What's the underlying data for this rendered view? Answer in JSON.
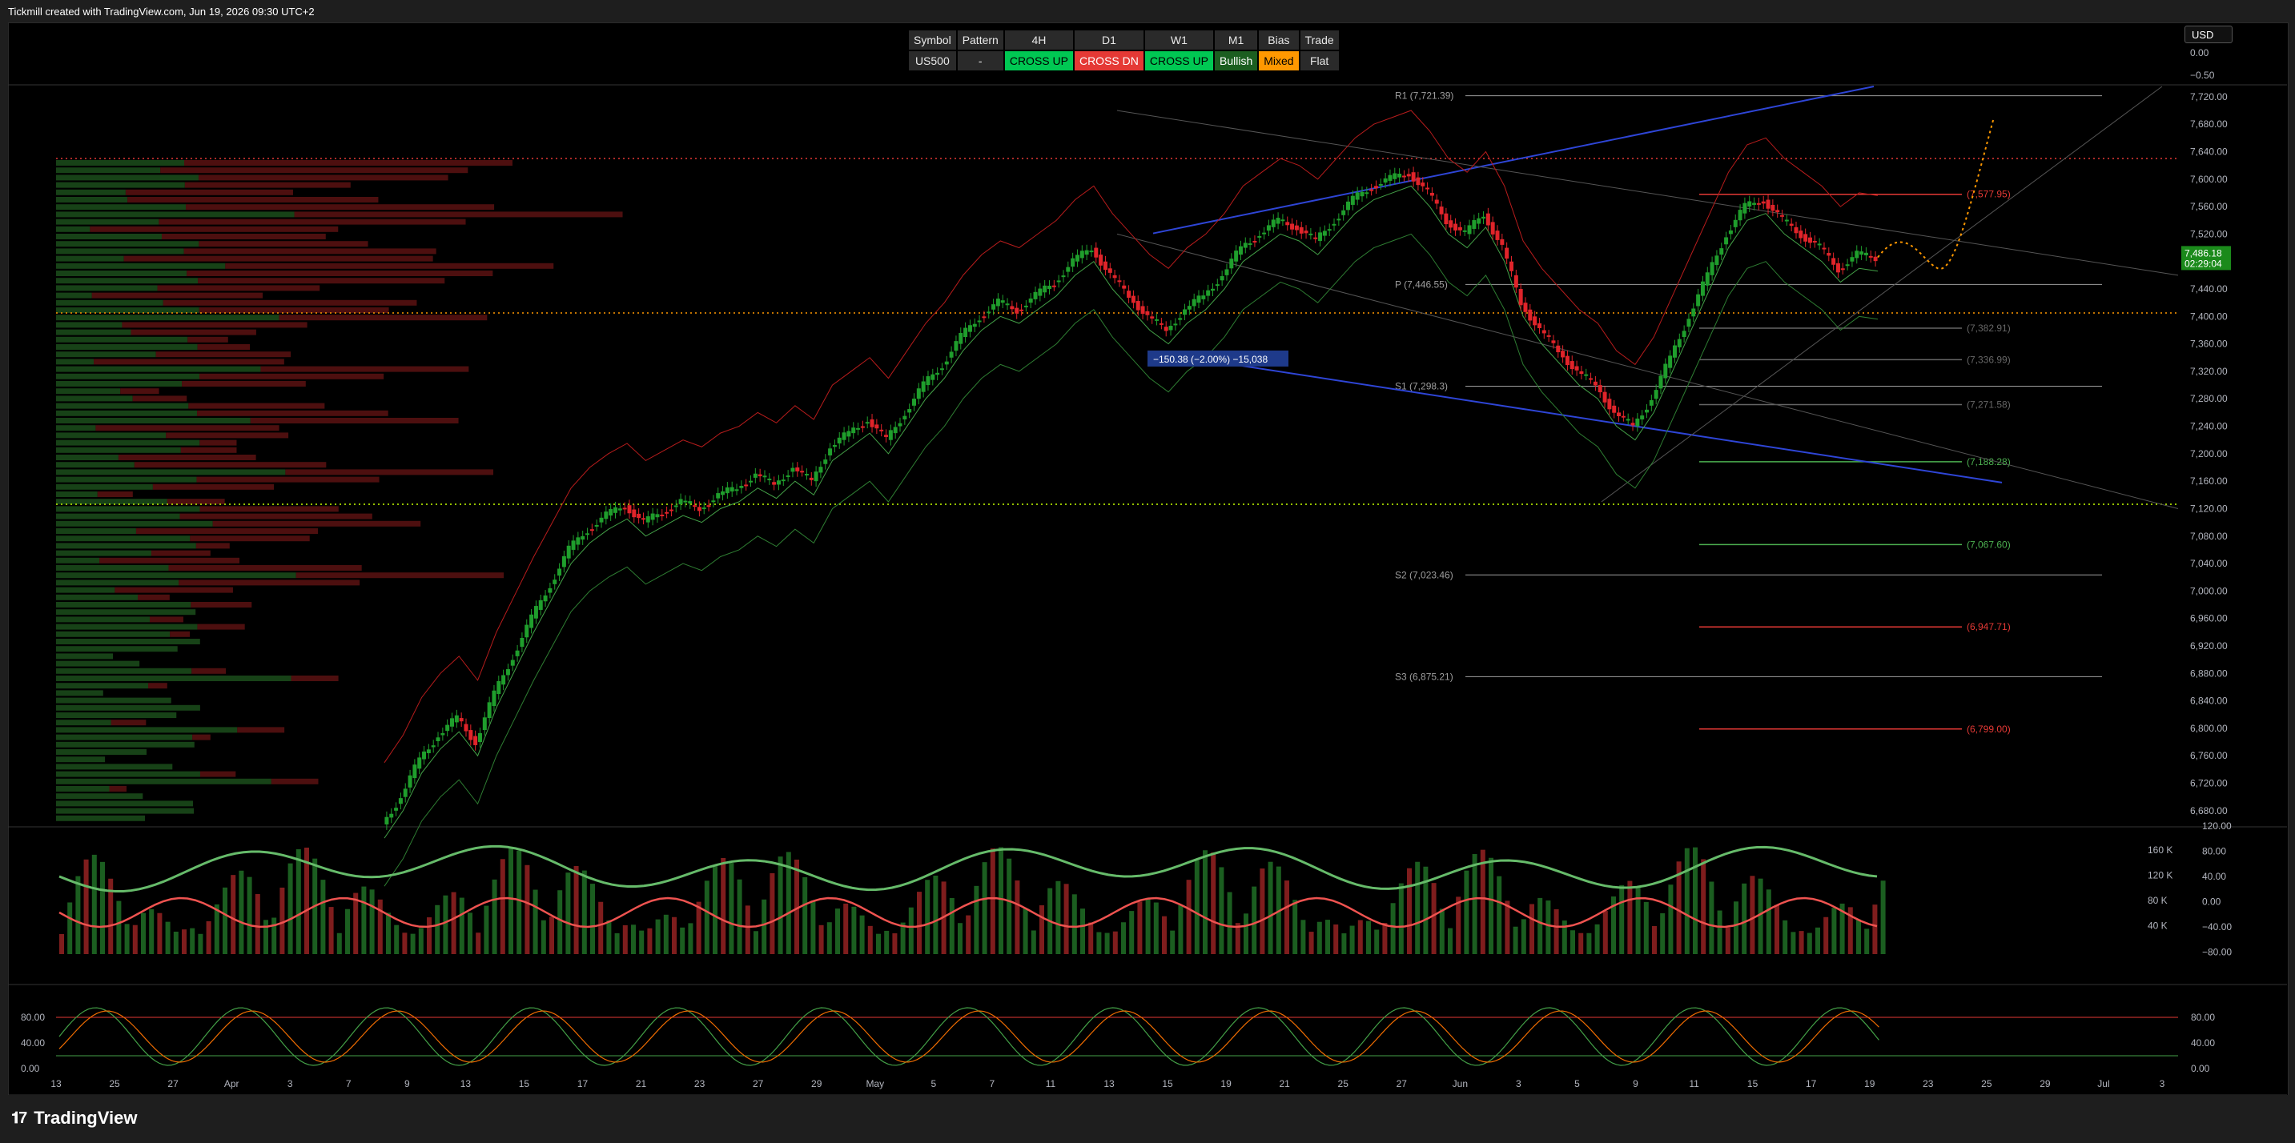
{
  "header": {
    "created_text": "Tickmill created with TradingView.com, Jun 19, 2026 09:30 UTC+2"
  },
  "currency_label": "USD",
  "signal_table": {
    "headers": [
      "Symbol",
      "Pattern",
      "4H",
      "D1",
      "W1",
      "M1",
      "Bias",
      "Trade"
    ],
    "row": [
      "US500",
      "-",
      "CROSS UP",
      "CROSS DN",
      "CROSS UP",
      "Bullish",
      "Mixed",
      "Flat"
    ]
  },
  "footer": {
    "brand": "TradingView",
    "icon": "tradingview-logo-icon"
  },
  "colors": {
    "up": "#26a69a",
    "candle_up": "#1f9e2c",
    "candle_down": "#e0242a",
    "accent_green": "#00c853",
    "accent_red": "#e53935",
    "orange": "#ff9800",
    "trend_blue": "#2e45d6"
  },
  "chart_data": [
    {
      "type": "candlestick",
      "symbol": "US500",
      "price_axis_labels": [
        "7,720.00",
        "7,680.00",
        "7,640.00",
        "7,600.00",
        "7,560.00",
        "7,520.00",
        "7,480.00",
        "7,440.00",
        "7,400.00",
        "7,360.00",
        "7,320.00",
        "7,280.00",
        "7,240.00",
        "7,200.00",
        "7,160.00",
        "7,120.00",
        "7,080.00",
        "7,040.00",
        "7,000.00",
        "6,960.00",
        "6,920.00",
        "6,880.00",
        "6,840.00",
        "6,800.00",
        "6,760.00",
        "6,720.00",
        "6,680.00"
      ],
      "ylim": [
        6660,
        7735
      ],
      "upper_scale_labels": [
        "0.00",
        "−0.50"
      ],
      "x_axis_labels": [
        "13",
        "25",
        "27",
        "Apr",
        "3",
        "7",
        "9",
        "13",
        "15",
        "17",
        "21",
        "23",
        "27",
        "29",
        "May",
        "5",
        "7",
        "11",
        "13",
        "15",
        "19",
        "21",
        "25",
        "27",
        "Jun",
        "3",
        "5",
        "9",
        "11",
        "15",
        "17",
        "19",
        "23",
        "25",
        "29",
        "Jul",
        "3"
      ],
      "last_price": {
        "value": "7,486.18",
        "countdown": "02:29:04"
      },
      "pivot_levels": [
        {
          "label": "R1 (7,721.39)",
          "value": 7721.39
        },
        {
          "label": "P (7,446.55)",
          "value": 7446.55
        },
        {
          "label": "S1 (7,298.3)",
          "value": 7298.3
        },
        {
          "label": "S2 (7,023.46)",
          "value": 7023.46
        },
        {
          "label": "S3 (6,875.21)",
          "value": 6875.21
        }
      ],
      "level_labels": [
        {
          "label": "(7,577.95)",
          "value": 7577.95,
          "color": "#e53935"
        },
        {
          "label": "(7,382.91)",
          "value": 7382.91,
          "color": "#666666"
        },
        {
          "label": "(7,336.99)",
          "value": 7336.99,
          "color": "#666666"
        },
        {
          "label": "(7,271.58)",
          "value": 7271.58,
          "color": "#666666"
        },
        {
          "label": "(7,188.28)",
          "value": 7188.28,
          "color": "#4caf50"
        },
        {
          "label": "(7,067.60)",
          "value": 7067.6,
          "color": "#4caf50"
        },
        {
          "label": "(6,947.71)",
          "value": 6947.71,
          "color": "#e53935"
        },
        {
          "label": "(6,799.00)",
          "value": 6799.0,
          "color": "#e53935"
        }
      ],
      "measure_label": "−150.38 (−2.00%) −15,038",
      "close_series": [
        6660,
        6700,
        6755,
        6790,
        6815,
        6780,
        6850,
        6905,
        6960,
        7010,
        7060,
        7090,
        7110,
        7125,
        7100,
        7115,
        7130,
        7120,
        7140,
        7150,
        7170,
        7155,
        7180,
        7160,
        7210,
        7230,
        7250,
        7220,
        7260,
        7300,
        7330,
        7370,
        7400,
        7420,
        7410,
        7430,
        7450,
        7480,
        7500,
        7460,
        7430,
        7400,
        7380,
        7410,
        7430,
        7460,
        7500,
        7520,
        7540,
        7530,
        7510,
        7540,
        7570,
        7590,
        7600,
        7610,
        7580,
        7540,
        7520,
        7550,
        7500,
        7420,
        7380,
        7350,
        7320,
        7300,
        7260,
        7240,
        7280,
        7340,
        7400,
        7460,
        7520,
        7560,
        7570,
        7540,
        7520,
        7500,
        7470,
        7490,
        7486
      ]
    },
    {
      "type": "bar",
      "name": "volume-oscillator-panel",
      "right_axis_labels": [
        "120.00",
        "80.00",
        "40.00",
        "0.00",
        "−40.00",
        "−80.00"
      ],
      "left_volume_labels": [
        "160 K",
        "120 K",
        "80 K",
        "40 K"
      ]
    },
    {
      "type": "line",
      "name": "stochastic-panel",
      "left_axis_labels": [
        "80.00",
        "40.00",
        "0.00"
      ],
      "right_axis_labels": [
        "80.00",
        "40.00",
        "0.00"
      ],
      "levels": [
        80,
        20
      ]
    }
  ]
}
